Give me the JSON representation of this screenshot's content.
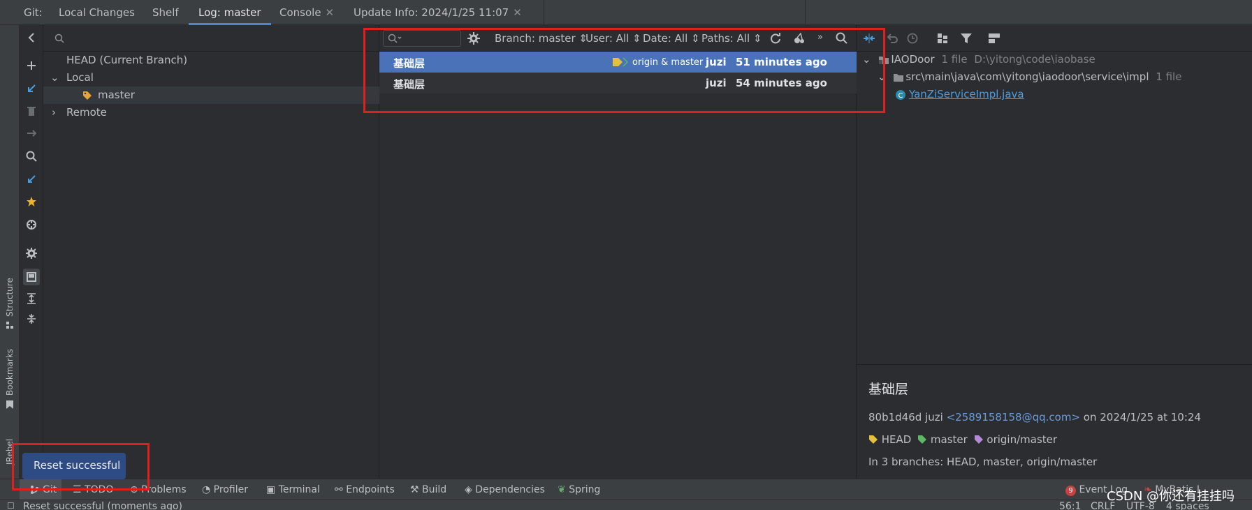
{
  "tabs": {
    "prefix": "Git:",
    "items": [
      {
        "label": "Local Changes"
      },
      {
        "label": "Shelf"
      },
      {
        "label": "Log: master"
      },
      {
        "label": "Console"
      },
      {
        "label": "Update Info: 2024/1/25 11:07"
      }
    ],
    "active": "Log: master"
  },
  "left_strip": {
    "structure": "Structure",
    "bookmarks": "Bookmarks",
    "jrebel": "JRebel"
  },
  "branches": {
    "head": "HEAD (Current Branch)",
    "local": "Local",
    "master": "master",
    "remote": "Remote"
  },
  "log": {
    "filters": {
      "branch": "Branch: master",
      "user": "User: All",
      "date": "Date: All",
      "paths": "Paths: All"
    },
    "commits": [
      {
        "message": "基础层",
        "refs": "origin & master",
        "author": "juzi",
        "date": "51 minutes ago"
      },
      {
        "message": "基础层",
        "refs": "",
        "author": "juzi",
        "date": "54 minutes ago"
      }
    ]
  },
  "changes": {
    "root": {
      "name": "IAODoor",
      "count": "1 file",
      "path": "D:\\yitong\\code\\iaobase"
    },
    "folder": {
      "name": "src\\main\\java\\com\\yitong\\iaodoor\\service\\impl",
      "count": "1 file"
    },
    "file": {
      "name": "YanZiServiceImpl.java"
    }
  },
  "details": {
    "title": "基础层",
    "hash": "80b1d46d",
    "author": "juzi",
    "email": "<2589158158@qq.com>",
    "on_date": "on 2024/1/25 at 10:24",
    "tags": [
      "HEAD",
      "master",
      "origin/master"
    ],
    "branches_line": "In 3 branches: HEAD, master, origin/master"
  },
  "bottom_tools": {
    "git": "Git",
    "todo": "TODO",
    "problems": "Problems",
    "profiler": "Profiler",
    "terminal": "Terminal",
    "endpoints": "Endpoints",
    "build": "Build",
    "dependencies": "Dependencies",
    "spring": "Spring",
    "event_log": "Event Log",
    "event_count": "9",
    "mybatis": "MyBatis L"
  },
  "status": {
    "message": "Reset successful (moments ago)",
    "position": "56:1",
    "line_sep": "CRLF",
    "encoding": "UTF-8",
    "indent": "4 spaces"
  },
  "toast": {
    "text": "Reset successful"
  },
  "watermark": "CSDN @你还有挂挂吗",
  "colors": {
    "accent": "#4a88c7",
    "selection": "#4a72b8",
    "highlight_box": "#e02020",
    "tag_yellow": "#e5c03b",
    "tag_green": "#5fb865",
    "tag_purple": "#b58bd8",
    "link": "#6b9bd8"
  }
}
